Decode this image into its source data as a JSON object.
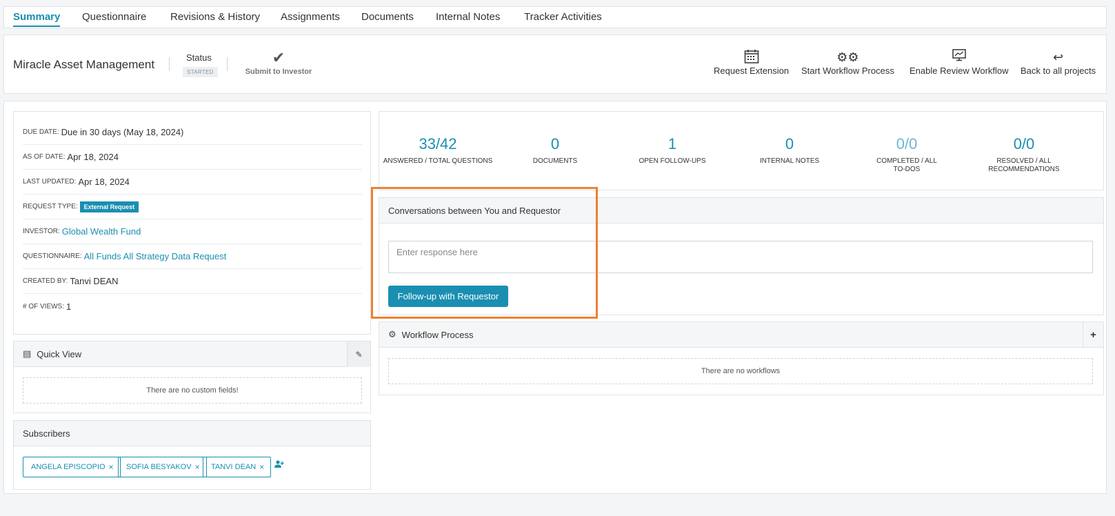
{
  "tabs": [
    "Summary",
    "Questionnaire",
    "Revisions & History",
    "Assignments",
    "Documents",
    "Internal Notes",
    "Tracker Activities"
  ],
  "header": {
    "company": "Miracle Asset Management",
    "status_label": "Status",
    "status_value": "STARTED",
    "submit_label": "Submit to Investor",
    "actions": [
      {
        "label": "Request Extension",
        "icon": "calendar-icon"
      },
      {
        "label": "Start Workflow Process",
        "icon": "gears-icon"
      },
      {
        "label": "Enable Review Workflow",
        "icon": "monitor-chart-icon"
      },
      {
        "label": "Back to all projects",
        "icon": "reply-arrow-icon"
      }
    ]
  },
  "info": {
    "due_date_label": "DUE DATE:",
    "due_date": "Due in 30 days (May 18, 2024)",
    "as_of_label": "AS OF DATE:",
    "as_of": "Apr 18, 2024",
    "last_updated_label": "LAST UPDATED:",
    "last_updated": "Apr 18, 2024",
    "request_type_label": "REQUEST TYPE:",
    "request_type": "External Request",
    "investor_label": "INVESTOR:",
    "investor": "Global Wealth Fund",
    "questionnaire_label": "QUESTIONNAIRE:",
    "questionnaire": "All Funds All Strategy Data Request",
    "created_by_label": "CREATED BY:",
    "created_by": "Tanvi DEAN",
    "views_label": "# OF VIEWS:",
    "views": "1"
  },
  "quick_view": {
    "title": "Quick View",
    "empty": "There are no custom fields!"
  },
  "subscribers": {
    "title": "Subscribers",
    "items": [
      "ANGELA EPISCOPIO",
      "SOFIA BESYAKOV",
      "TANVI DEAN"
    ],
    "remove_glyph": "×"
  },
  "stats": [
    {
      "value": "33/42",
      "caption": "ANSWERED / TOTAL QUESTIONS"
    },
    {
      "value": "0",
      "caption": "DOCUMENTS"
    },
    {
      "value": "1",
      "caption": "OPEN FOLLOW-UPS"
    },
    {
      "value": "0",
      "caption": "INTERNAL NOTES"
    },
    {
      "value": "0/0",
      "caption": "COMPLETED / ALL TO-DOS"
    },
    {
      "value": "0/0",
      "caption": "RESOLVED / ALL RECOMMENDATIONS"
    }
  ],
  "conversations": {
    "title": "Conversations between You and Requestor",
    "placeholder": "Enter response here",
    "button": "Follow-up with Requestor"
  },
  "workflow": {
    "title": "Workflow Process",
    "empty": "There are no workflows"
  },
  "colors": {
    "accent": "#1a8fb1",
    "highlight": "#f08030"
  }
}
